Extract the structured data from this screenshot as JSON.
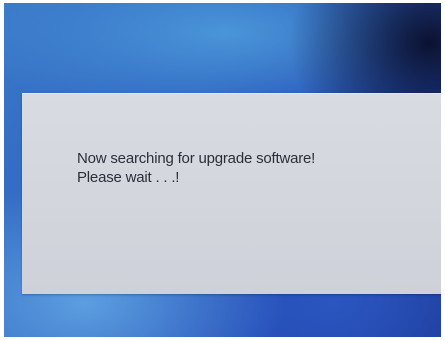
{
  "dialog": {
    "line1": "Now searching for upgrade software!",
    "line2": "Please wait . . .!"
  },
  "colors": {
    "background_blue": "#2e63c0",
    "dialog_gray": "#d5d7de",
    "text": "#2c2f3a"
  }
}
